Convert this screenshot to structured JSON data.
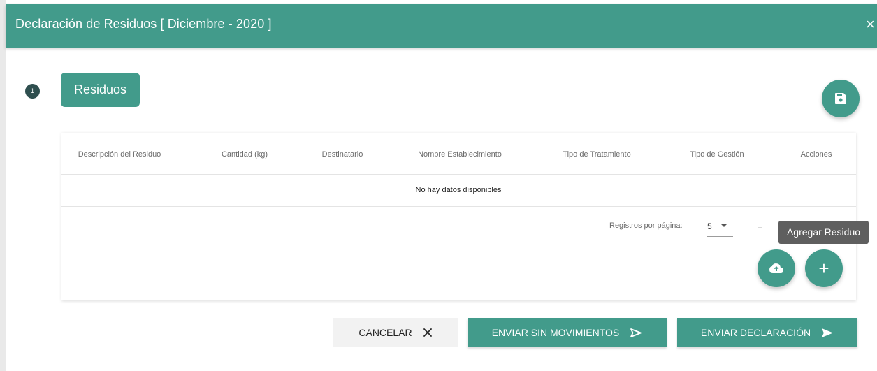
{
  "window": {
    "title": "Declaración de Residuos [ Diciembre - 2020 ]",
    "close_symbol": "×",
    "accent_color": "#429b8b"
  },
  "step": {
    "number": "1",
    "label": "Residuos"
  },
  "table": {
    "columns": [
      "Descripción del Residuo",
      "Cantidad (kg)",
      "Destinatario",
      "Nombre Establecimiento",
      "Tipo de Tratamiento",
      "Tipo de Gestión",
      "Acciones"
    ],
    "empty_message": "No hay datos disponibles",
    "pagination": {
      "rows_per_page_label": "Registros por página:",
      "rows_per_page_value": "5",
      "range_text": "–"
    }
  },
  "tooltip": {
    "text": "Agregar Residuo"
  },
  "fabs": {
    "save_icon": "save-icon",
    "upload_icon": "cloud-upload-icon",
    "add_symbol": "+"
  },
  "actions": {
    "cancel_label": "CANCELAR",
    "send_no_movements_label": "ENVIAR SIN MOVIMIENTOS",
    "send_declaration_label": "ENVIAR DECLARACIÓN"
  }
}
